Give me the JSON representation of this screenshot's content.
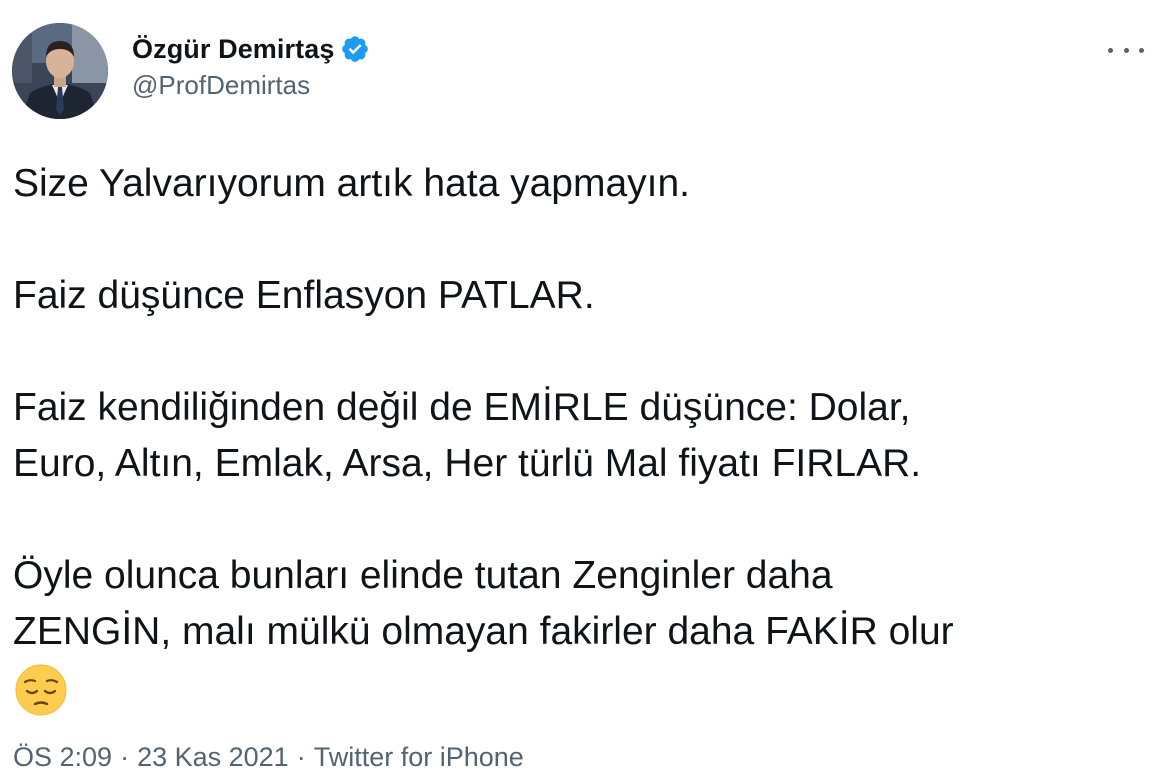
{
  "author": {
    "display_name": "Özgür Demirtaş",
    "handle": "@ProfDemirtas",
    "verified": true,
    "avatar_icon": "profile-photo"
  },
  "menu_icon": "more-horizontal-icon",
  "tweet": {
    "lines": [
      "Size Yalvarıyorum artık hata yapmayın.",
      "Faiz düşünce Enflasyon PATLAR.",
      "Faiz kendiliğinden değil de EMİRLE düşünce: Dolar,",
      "Euro, Altın, Emlak, Arsa, Her türlü Mal fiyatı FIRLAR.",
      "Öyle olunca bunları elinde tutan Zenginler daha",
      "ZENGİN, malı mülkü olmayan fakirler daha FAKİR olur"
    ],
    "emoji": "pensive-face-emoji"
  },
  "meta": {
    "time": "ÖS 2:09",
    "separator": "·",
    "date": "23 Kas 2021",
    "source": "Twitter for iPhone"
  },
  "colors": {
    "text": "#0f1419",
    "secondary": "#536471",
    "verified_blue": "#1d9bf0"
  }
}
